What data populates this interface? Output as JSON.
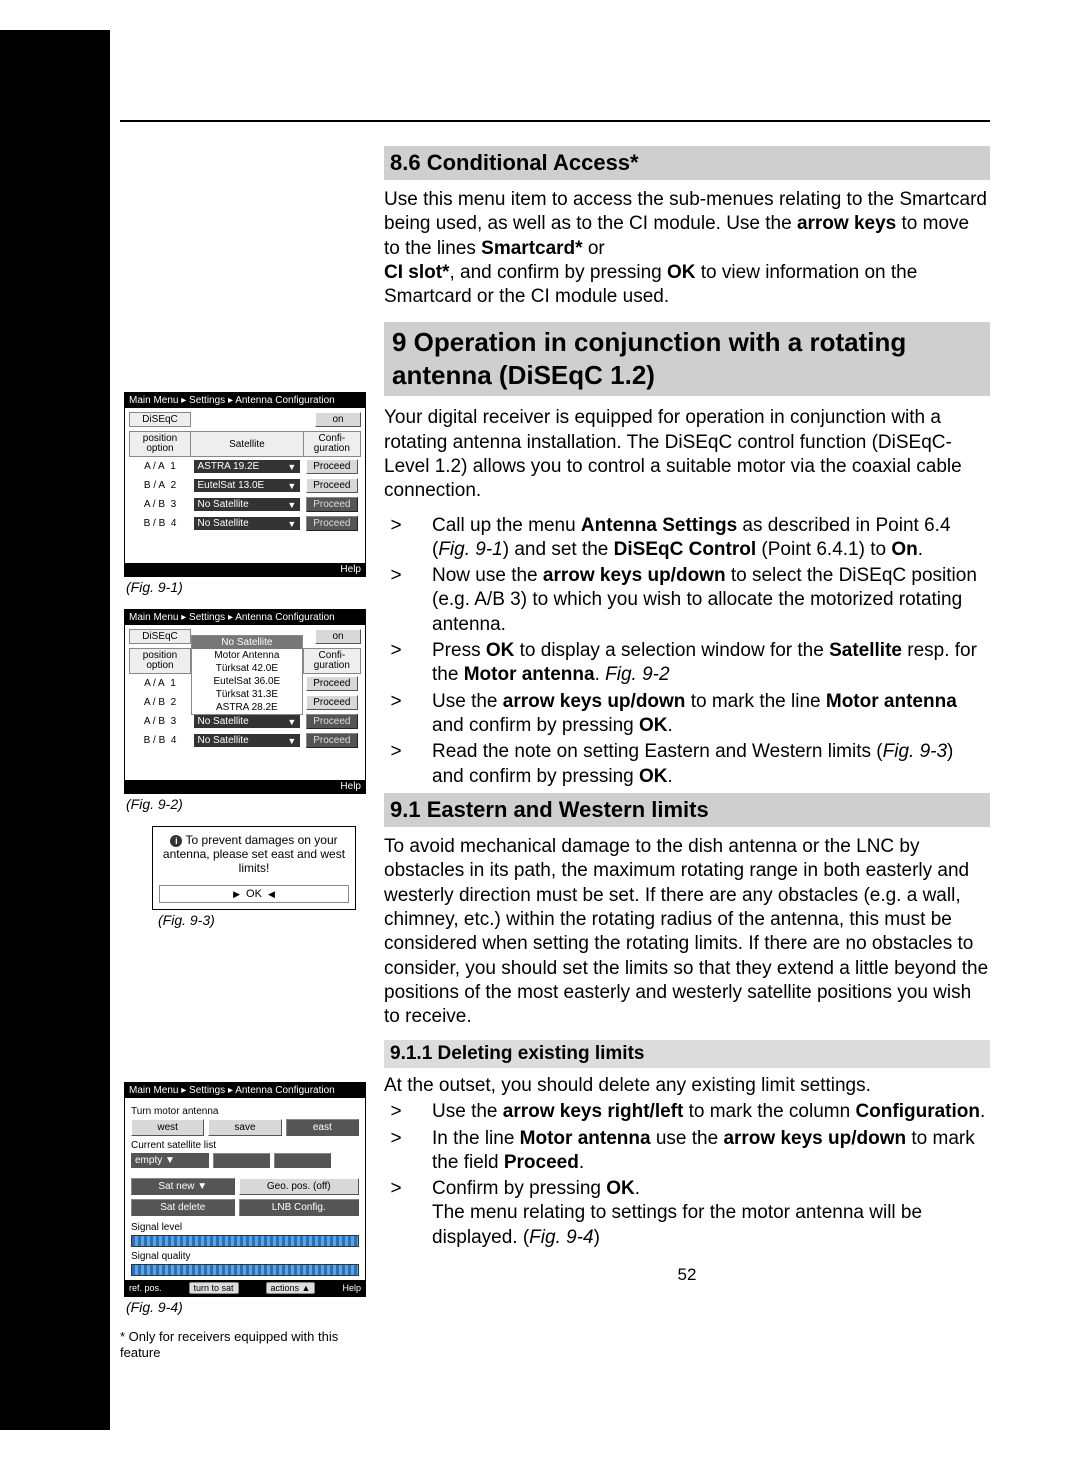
{
  "page_number": "52",
  "footnote": "* Only for receivers equipped with this feature",
  "sections": {
    "s86": {
      "heading": "8.6 Conditional Access*",
      "para_pre": "Use this menu item to access the sub-menues relating to the Smartcard being used, as well as to the CI module. Use the ",
      "bold1": "arrow keys",
      "para_mid1": " to move to the lines ",
      "bold2": "Smartcard*",
      "para_mid2": " or ",
      "bold3": "CI slot*",
      "para_mid3": ", and confirm by pressing ",
      "bold4": "OK",
      "para_end": " to view information on the Smartcard or the CI module used."
    },
    "chap9": {
      "heading": "9 Operation in conjunction with a rotating antenna (DiSEqC 1.2)",
      "intro": "Your digital receiver is equipped for operation in conjunction with a rotating antenna installation. The  DiSEqC control function (DiSEqC-Level 1.2) allows you to control a suitable motor via the coaxial cable connection.",
      "bullets": [
        {
          "pre": "Call up the menu ",
          "b1": "Antenna Settings",
          "mid1": " as described in Point 6.4 ",
          "i1": "Fig. 9-1",
          "mid2": ") and set the  ",
          "b2": "DiSEqC Control",
          "mid3": " (Point 6.4.1) to ",
          "b3": "On",
          "end": "."
        },
        {
          "pre": "Now use the ",
          "b1": "arrow keys up/down",
          "mid1": " to select the DiSEqC position (e.g. A/B 3) to which you wish to allocate the motorized  rotating antenna.",
          "b2": "",
          "mid2": "",
          "i1": "",
          "mid3": "",
          "b3": "",
          "end": ""
        },
        {
          "pre": "Press ",
          "b1": "OK",
          "mid1": " to display a selection window for the ",
          "b2": "Satellite",
          "mid2": " resp. for the ",
          "b3": "Motor antenna",
          "mid3": ". ",
          "i1": "Fig. 9-2",
          "end": ""
        },
        {
          "pre": "Use the ",
          "b1": "arrow keys up/down",
          "mid1": " to mark the line ",
          "b2": "Motor antenna",
          "mid2": " and confirm by pressing ",
          "b3": "OK",
          "mid3": ".",
          "i1": "",
          "end": ""
        },
        {
          "pre": "Read the note on setting Eastern and Western limits ",
          "i1": "Fig. 9-3",
          "mid1": ") and confirm by pressing ",
          "b1": "OK",
          "mid2": ".",
          "b2": "",
          "b3": "",
          "mid3": "",
          "end": ""
        }
      ]
    },
    "s91": {
      "heading": "9.1 Eastern and Western limits",
      "para": "To avoid mechanical damage to the dish antenna or the LNC by obstacles in its path, the maximum rotating range in both easterly and westerly direction must be set. If there are any obstacles (e.g. a wall, chimney, etc.) within the rotating radius of the antenna, this must be considered when setting the rotating limits. If there are no obstacles to consider, you should set the limits so that they extend a little beyond the positions of the most easterly and westerly satellite positions you wish to receive."
    },
    "s911": {
      "heading": "9.1.1 Deleting existing limits",
      "intro": "At the outset, you should delete any existing limit settings.",
      "bullets": [
        {
          "pre": "Use the ",
          "b1": "arrow keys right/left",
          "mid1": " to mark the column ",
          "b2": "Configuration",
          "end": "."
        },
        {
          "pre": "In the line ",
          "b1": "Motor antenna",
          "mid1": " use the ",
          "b2": "arrow keys up/down",
          "mid2": " to mark the field ",
          "b3": "Proceed",
          "end": "."
        },
        {
          "pre": "Confirm by pressing ",
          "b1": "OK",
          "mid1": ".",
          "end": "",
          "sub": "The menu relating to settings for the motor antenna will be displayed. ",
          "i1": "Fig. 9-4"
        }
      ]
    }
  },
  "figs": {
    "breadcrumb": "Main Menu ▸ Settings ▸ Antenna Configuration",
    "diseqc_label": "DiSEqC",
    "on_label": "on",
    "pos_opt": "position option",
    "sat_hdr": "Satellite",
    "conf_hdr": "Confi-guration",
    "help": "Help",
    "proceed": "Proceed",
    "rows1": [
      {
        "p": "A / A",
        "n": "1",
        "s": "ASTRA 19.2E",
        "dark": false
      },
      {
        "p": "B / A",
        "n": "2",
        "s": "EutelSat 13.0E",
        "dark": false
      },
      {
        "p": "A / B",
        "n": "3",
        "s": "No Satellite",
        "dark": true
      },
      {
        "p": "B / B",
        "n": "4",
        "s": "No Satellite",
        "dark": true
      }
    ],
    "cap1": "(Fig. 9-1)",
    "dd2": [
      "No Satellite",
      "Motor Antenna",
      "Türksat 42.0E",
      "EutelSat 36.0E",
      "Türksat 31.3E",
      "ASTRA 28.2E"
    ],
    "rows2": [
      {
        "p": "A / A",
        "n": "1",
        "dark": false
      },
      {
        "p": "A / B",
        "n": "2",
        "dark": false
      },
      {
        "p": "A / B",
        "n": "3",
        "s": "No Satellite",
        "dark": true
      },
      {
        "p": "B / B",
        "n": "4",
        "s": "No Satellite",
        "dark": true
      }
    ],
    "cap2": "(Fig. 9-2)",
    "fig3_text": "To prevent damages on your antenna, please set east and west limits!",
    "fig3_ok": "OK",
    "cap3": "(Fig. 9-3)",
    "fig4": {
      "turn_label": "Turn motor antenna",
      "west": "west",
      "save": "save",
      "east": "east",
      "cur_label": "Current satellite list",
      "empty": "empty",
      "satnew": "Sat new",
      "geo": "Geo. pos. (off)",
      "satdel": "Sat delete",
      "lnb": "LNB Config.",
      "siglvl": "Signal level",
      "sigq": "Signal quality",
      "refpos": "ref. pos.",
      "turnto": "turn to sat",
      "actions": "actions",
      "help": "Help"
    },
    "cap4": "(Fig. 9-4)"
  }
}
